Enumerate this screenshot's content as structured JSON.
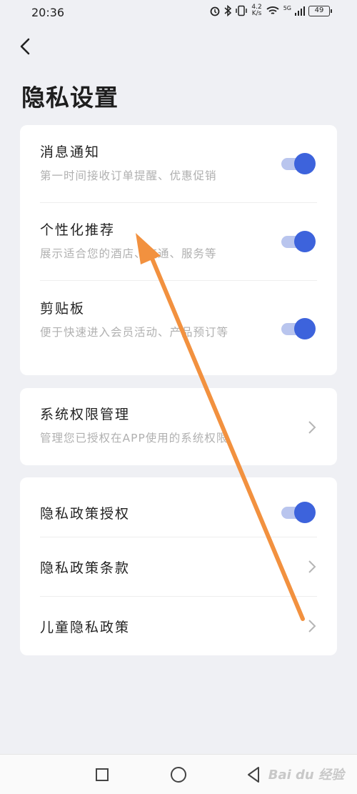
{
  "status_bar": {
    "time": "20:36",
    "net_speed": "4.2",
    "net_unit": "K/s",
    "signal_label": "5G",
    "battery": "49"
  },
  "page": {
    "title": "隐私设置"
  },
  "settings_group_1": [
    {
      "title": "消息通知",
      "desc": "第一时间接收订单提醒、优惠促销",
      "enabled": true
    },
    {
      "title": "个性化推荐",
      "desc": "展示适合您的酒店、交通、服务等",
      "enabled": true
    },
    {
      "title": "剪贴板",
      "desc": "便于快速进入会员活动、产品预订等",
      "enabled": true
    }
  ],
  "settings_group_2": [
    {
      "title": "系统权限管理",
      "desc": "管理您已授权在APP使用的系统权限"
    }
  ],
  "settings_group_3": [
    {
      "title": "隐私政策授权",
      "enabled": true
    },
    {
      "title": "隐私政策条款"
    },
    {
      "title": "儿童隐私政策"
    }
  ],
  "watermark": "Bai du 经验",
  "colors": {
    "accent": "#3d63dc",
    "toggle_track": "#b9c5ee",
    "annotation_arrow": "#f2913f",
    "background": "#eff0f4"
  },
  "icons": [
    "alarm-icon",
    "bluetooth-icon",
    "vibrate-icon",
    "wifi-icon",
    "signal-icon",
    "battery-icon",
    "back-arrow-icon",
    "chevron-right-icon",
    "recents-icon",
    "home-icon",
    "back-icon"
  ]
}
